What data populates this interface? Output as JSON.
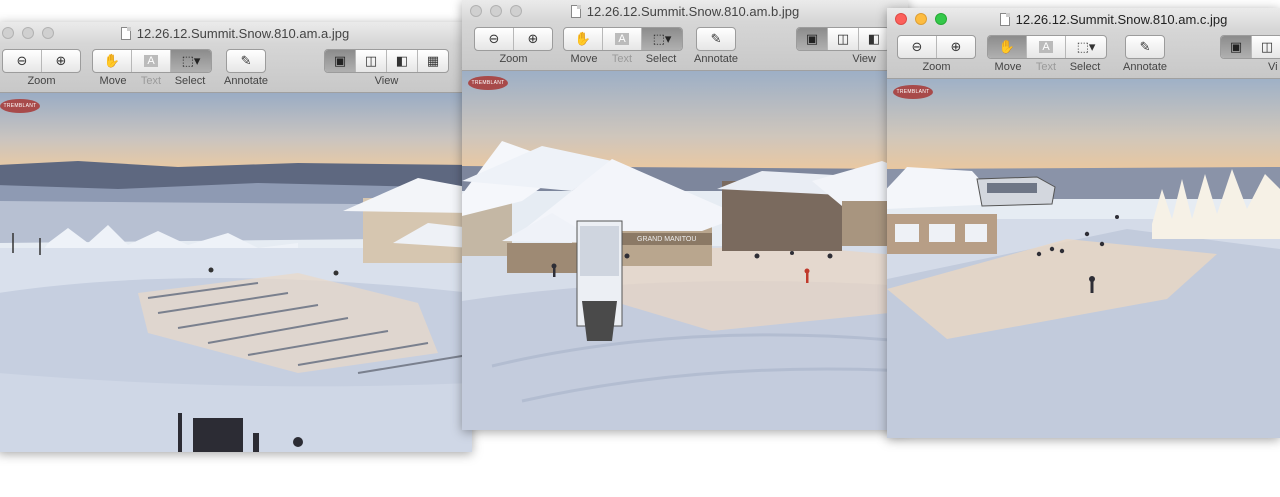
{
  "windows": [
    {
      "id": "a",
      "title": "12.26.12.Summit.Snow.810.am.a.jpg",
      "active": false,
      "labels": {
        "zoom": "Zoom",
        "move": "Move",
        "text": "Text",
        "select": "Select",
        "annotate": "Annotate",
        "view": "View"
      }
    },
    {
      "id": "b",
      "title": "12.26.12.Summit.Snow.810.am.b.jpg",
      "active": false,
      "labels": {
        "zoom": "Zoom",
        "move": "Move",
        "text": "Text",
        "select": "Select",
        "annotate": "Annotate",
        "view": "View"
      }
    },
    {
      "id": "c",
      "title": "12.26.12.Summit.Snow.810.am.c.jpg",
      "active": true,
      "labels": {
        "zoom": "Zoom",
        "move": "Move",
        "text": "Text",
        "select": "Select",
        "annotate": "Annotate",
        "view": "Vi"
      }
    }
  ],
  "photo": {
    "logo_text": "TREMBLANT",
    "building_sign": "GRAND MANITOU"
  },
  "icons": {
    "zoom_out": "magnify-minus-icon",
    "zoom_in": "magnify-plus-icon",
    "move": "hand-icon",
    "text": "text-tool-icon",
    "select": "marquee-select-icon",
    "annotate": "pencil-icon",
    "view": "view-mode-icon"
  },
  "colors": {
    "sky_top": "#9fb0c6",
    "sky_horizon": "#e7c9a6",
    "snow": "#dfe5ef",
    "snow_shadow": "#aab6cf",
    "logo": "#a84a4a"
  }
}
